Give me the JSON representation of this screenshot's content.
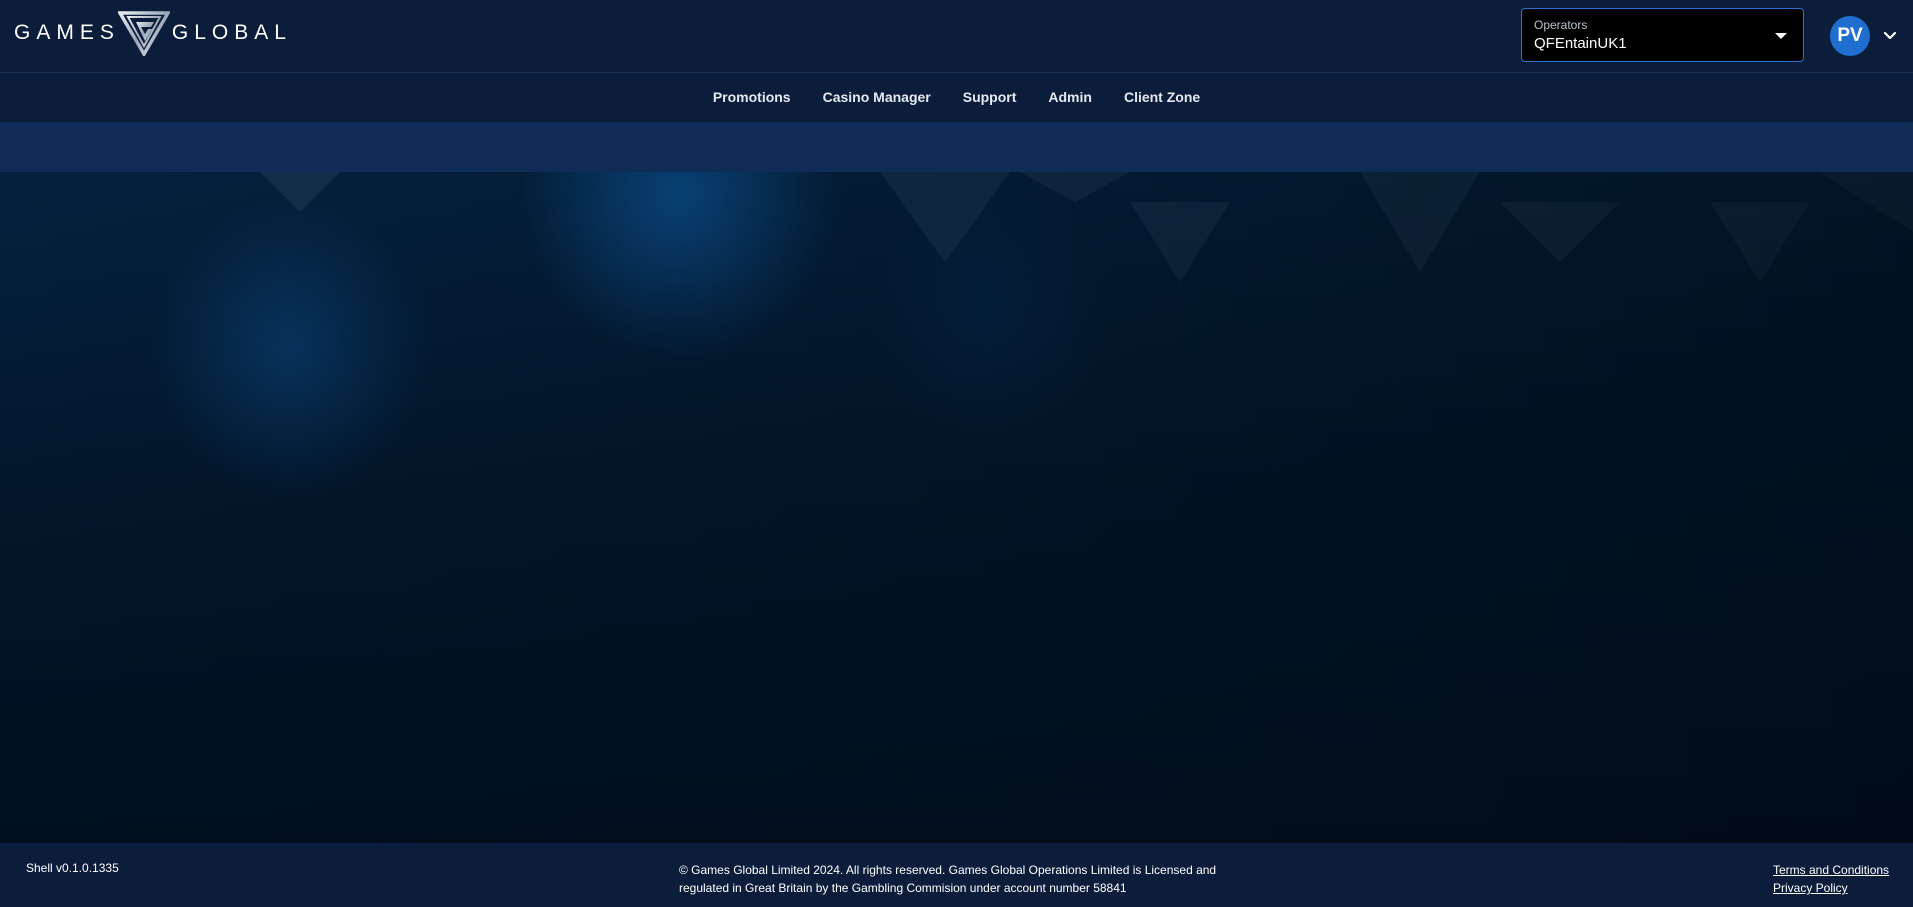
{
  "header": {
    "logo": {
      "left_word": "GAMES",
      "right_word": "GLOBAL",
      "mark_icon": "gg-triangle-logo"
    },
    "operators": {
      "label": "Operators",
      "value": "QFEntainUK1",
      "caret_icon": "caret-down-icon"
    },
    "user": {
      "initials": "PV",
      "avatar_color": "#1f6fd1",
      "chevron_icon": "chevron-down-icon"
    }
  },
  "nav": {
    "items": [
      {
        "label": "Promotions"
      },
      {
        "label": "Casino Manager"
      },
      {
        "label": "Support"
      },
      {
        "label": "Admin"
      },
      {
        "label": "Client Zone"
      }
    ]
  },
  "footer": {
    "version": "Shell v0.1.0.1335",
    "copyright_line1": "© Games Global Limited 2024. All rights reserved. Games Global Operations Limited is Licensed and",
    "copyright_line2": "regulated in Great Britain by the Gambling Commision under account number 58841",
    "terms_label": "Terms and Conditions",
    "privacy_label": "Privacy Policy"
  },
  "colors": {
    "header_bg": "#0b1d3b",
    "subbar_bg": "#0f2c57",
    "accent_border": "#2a6fd6"
  }
}
